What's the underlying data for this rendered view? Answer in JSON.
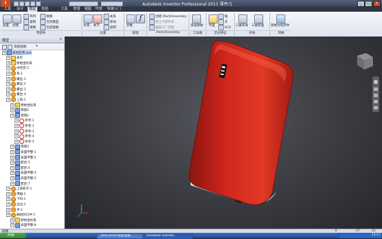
{
  "window": {
    "title": "Autodesk Inventor Professional 2011   零件几"
  },
  "menu": [
    "工具",
    "设计",
    "模型",
    "检验",
    "工具",
    "管理",
    "视图",
    "环境",
    "快速入门"
  ],
  "ribbon": {
    "place": "放置",
    "create": "创建",
    "array": "阵列",
    "copy": "复制",
    "mirror": "镜像",
    "replace": "替换",
    "pkg": "包装模型",
    "pkg2": "包装替换",
    "constraint": "约束",
    "relation": "关系",
    "parameter": "参数",
    "joint": "关节",
    "move": "移动",
    "rotate": "旋转",
    "ilogic": "iPart/iAssembly",
    "make_part": "创建 iPart/iAssembly",
    "create_ilogic": "建立子部件表",
    "edit_factory": "编辑工厂范围",
    "replace_part": "快速替换",
    "work_features": "平面",
    "axis": "轴",
    "point": "点",
    "ucs": "UCS",
    "three_layout": "三维布线",
    "three_manage": "三维管理",
    "convert": "转换为焦焊件",
    "group_component": "零部件",
    "group_position": "位置",
    "group_manage": "管理",
    "group_productivity": "工具箱",
    "group_work": "定位特征",
    "group_begin": "开始",
    "group_convert": "转换"
  },
  "panel": {
    "title": "模型",
    "filter": "装配视图",
    "tree": [
      "适合缸完.iam",
      "表示",
      "原始坐标系",
      "中壳壳:1",
      "系:1",
      "螺丝:1",
      "螺丝:2",
      "螺丝:3",
      "螺丝:4",
      "上盖:1",
      "原始坐标系",
      "草图1",
      "草图2",
      "参考:1",
      "参考:2",
      "参考:3",
      "参考:4",
      "参考:5",
      "草图3",
      "表面平整:1",
      "表面平整:2",
      "配合:3",
      "配合:4",
      "表面平整:4",
      "表面平整:5",
      "配合:7",
      "上盖影子:1",
      "用轴:1",
      "下料:1",
      "边沿:1",
      "手:1",
      "群组封口中:1",
      "原始坐标系",
      "表面平整:8"
    ]
  },
  "status": {
    "left": "就绪",
    "counts": [
      "0",
      "27",
      "21"
    ]
  },
  "taskbar": {
    "start": "开始",
    "tasks": [
      "DOC20101导航资源...",
      "Autodesk Invento..."
    ],
    "clock": "11:17"
  },
  "colors": {
    "case": "#c8221a",
    "viewport": "#3a3b40"
  }
}
